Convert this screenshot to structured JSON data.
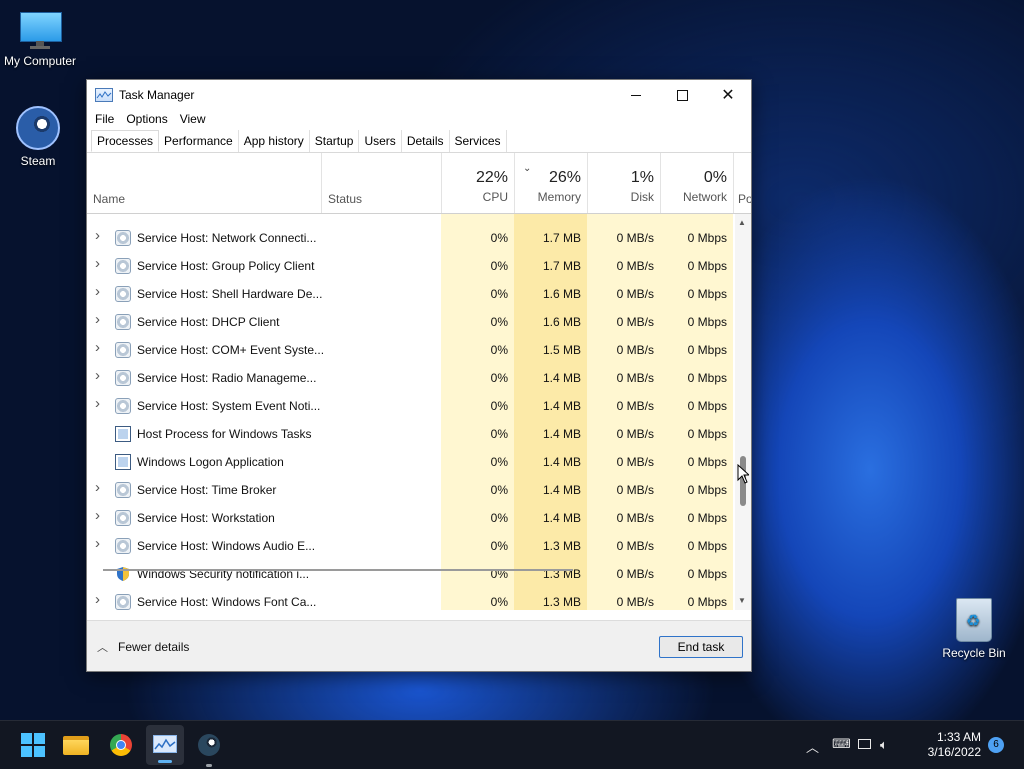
{
  "desktop": {
    "icons": [
      {
        "label": "My Computer"
      },
      {
        "label": "Steam"
      },
      {
        "label": "Recycle Bin"
      }
    ]
  },
  "window": {
    "title": "Task Manager",
    "menu": [
      "File",
      "Options",
      "View"
    ],
    "tabs": [
      "Processes",
      "Performance",
      "App history",
      "Startup",
      "Users",
      "Details",
      "Services"
    ],
    "active_tab": "Processes",
    "columns": {
      "name": "Name",
      "status": "Status",
      "cpu": {
        "pct": "22%",
        "label": "CPU"
      },
      "memory": {
        "pct": "26%",
        "label": "Memory"
      },
      "disk": {
        "pct": "1%",
        "label": "Disk"
      },
      "network": {
        "pct": "0%",
        "label": "Network"
      },
      "power_partial": "Po"
    },
    "rows": [
      {
        "name": "Service Host: Network Connecti...",
        "icon": "gear-icon",
        "expandable": true,
        "cpu": "0%",
        "memory": "1.7 MB",
        "disk": "0 MB/s",
        "network": "0 Mbps"
      },
      {
        "name": "Service Host: Group Policy Client",
        "icon": "gear-icon",
        "expandable": true,
        "cpu": "0%",
        "memory": "1.7 MB",
        "disk": "0 MB/s",
        "network": "0 Mbps"
      },
      {
        "name": "Service Host: Shell Hardware De...",
        "icon": "gear-icon",
        "expandable": true,
        "cpu": "0%",
        "memory": "1.6 MB",
        "disk": "0 MB/s",
        "network": "0 Mbps"
      },
      {
        "name": "Service Host: DHCP Client",
        "icon": "gear-icon",
        "expandable": true,
        "cpu": "0%",
        "memory": "1.6 MB",
        "disk": "0 MB/s",
        "network": "0 Mbps"
      },
      {
        "name": "Service Host: COM+ Event Syste...",
        "icon": "gear-icon",
        "expandable": true,
        "cpu": "0%",
        "memory": "1.5 MB",
        "disk": "0 MB/s",
        "network": "0 Mbps"
      },
      {
        "name": "Service Host: Radio Manageme...",
        "icon": "gear-icon",
        "expandable": true,
        "cpu": "0%",
        "memory": "1.4 MB",
        "disk": "0 MB/s",
        "network": "0 Mbps"
      },
      {
        "name": "Service Host: System Event Noti...",
        "icon": "gear-icon",
        "expandable": true,
        "cpu": "0%",
        "memory": "1.4 MB",
        "disk": "0 MB/s",
        "network": "0 Mbps"
      },
      {
        "name": "Host Process for Windows Tasks",
        "icon": "window-icon",
        "expandable": false,
        "cpu": "0%",
        "memory": "1.4 MB",
        "disk": "0 MB/s",
        "network": "0 Mbps"
      },
      {
        "name": "Windows Logon Application",
        "icon": "window-icon",
        "expandable": false,
        "cpu": "0%",
        "memory": "1.4 MB",
        "disk": "0 MB/s",
        "network": "0 Mbps"
      },
      {
        "name": "Service Host: Time Broker",
        "icon": "gear-icon",
        "expandable": true,
        "cpu": "0%",
        "memory": "1.4 MB",
        "disk": "0 MB/s",
        "network": "0 Mbps"
      },
      {
        "name": "Service Host: Workstation",
        "icon": "gear-icon",
        "expandable": true,
        "cpu": "0%",
        "memory": "1.4 MB",
        "disk": "0 MB/s",
        "network": "0 Mbps"
      },
      {
        "name": "Service Host: Windows Audio E...",
        "icon": "gear-icon",
        "expandable": true,
        "cpu": "0%",
        "memory": "1.3 MB",
        "disk": "0 MB/s",
        "network": "0 Mbps"
      },
      {
        "name": "Windows Security notification i...",
        "icon": "shield-icon",
        "expandable": false,
        "cpu": "0%",
        "memory": "1.3 MB",
        "disk": "0 MB/s",
        "network": "0 Mbps"
      },
      {
        "name": "Service Host: Windows Font Ca...",
        "icon": "gear-icon",
        "expandable": true,
        "cpu": "0%",
        "memory": "1.3 MB",
        "disk": "0 MB/s",
        "network": "0 Mbps"
      }
    ],
    "footer": {
      "fewer_details": "Fewer details",
      "end_task": "End task"
    }
  },
  "taskbar": {
    "clock_time": "1:33 AM",
    "clock_date": "3/16/2022",
    "notification_count": "6"
  },
  "colors": {
    "cpu_column": "#fff7d1",
    "memory_column": "#fceaa8",
    "disk_column": "#fff7d1",
    "network_column": "#fff7d1",
    "accent": "#2f73c9"
  }
}
